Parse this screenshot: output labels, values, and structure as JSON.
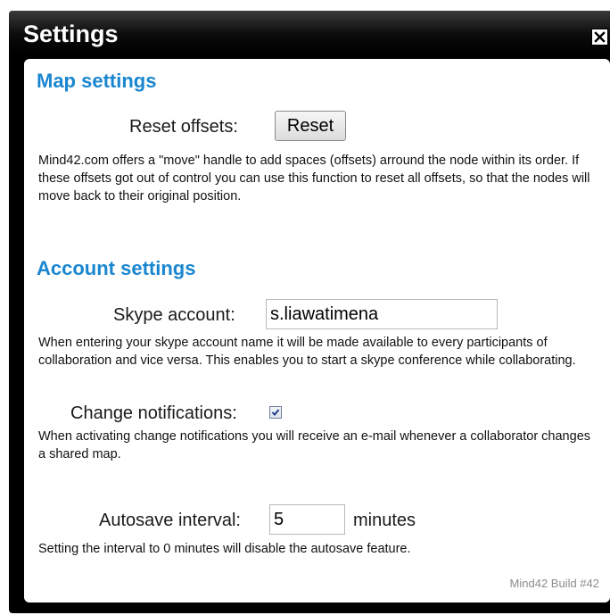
{
  "dialog": {
    "title": "Settings",
    "close_icon": "close-icon"
  },
  "map_settings": {
    "heading": "Map settings",
    "reset_offsets_label": "Reset offsets:",
    "reset_button_label": "Reset",
    "description": "Mind42.com offers a \"move\" handle to add spaces (offsets) arround the node within its order. If these offsets got out of control you can use this function to reset all offsets, so that the nodes will move back to their original position."
  },
  "account_settings": {
    "heading": "Account settings",
    "skype_label": "Skype account:",
    "skype_value": "s.liawatimena",
    "skype_description": "When entering your skype account name it will be made available to every participants of collaboration and vice versa. This enables you to start a skype conference while collaborating.",
    "notifications_label": "Change notifications:",
    "notifications_checked": true,
    "notifications_description": "When activating change notifications you will receive an e-mail whenever a collaborator changes a shared map.",
    "autosave_label": "Autosave interval:",
    "autosave_value": "5",
    "autosave_unit": "minutes",
    "autosave_description": "Setting the interval to 0 minutes will disable the autosave feature."
  },
  "footer": {
    "build": "Mind42 Build #42"
  },
  "colors": {
    "heading": "#1a86d0",
    "titlebar": "#000000"
  }
}
